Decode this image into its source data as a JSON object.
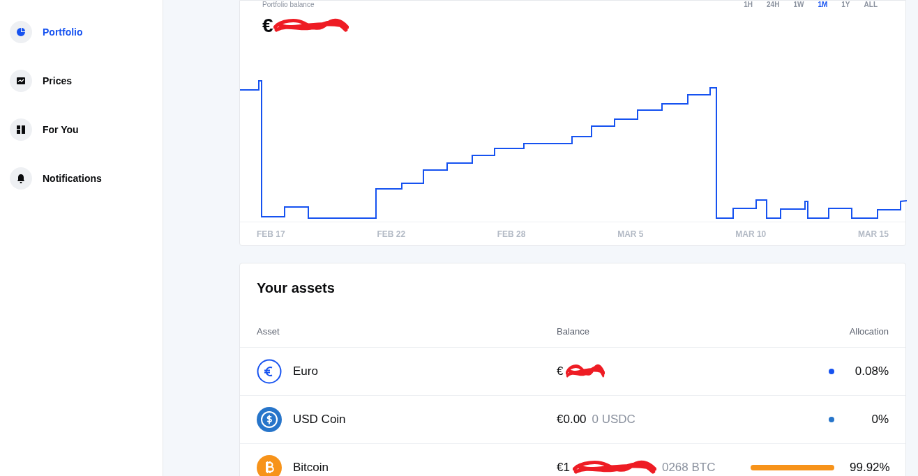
{
  "sidebar": {
    "items": [
      {
        "label": "Portfolio",
        "kind": "pie",
        "selected": true
      },
      {
        "label": "Prices",
        "kind": "chart",
        "selected": false
      },
      {
        "label": "For You",
        "kind": "grid",
        "selected": false
      },
      {
        "label": "Notifications",
        "kind": "bell",
        "selected": false
      }
    ]
  },
  "balance": {
    "label": "Portfolio balance",
    "value": "€"
  },
  "ranges": [
    {
      "label": "1H",
      "selected": false
    },
    {
      "label": "24H",
      "selected": false
    },
    {
      "label": "1W",
      "selected": false
    },
    {
      "label": "1M",
      "selected": true
    },
    {
      "label": "1Y",
      "selected": false
    },
    {
      "label": "ALL",
      "selected": false
    }
  ],
  "chart": {
    "x_labels": [
      "FEB 17",
      "FEB 22",
      "FEB 28",
      "MAR 5",
      "MAR 10",
      "MAR 15"
    ]
  },
  "assets": {
    "title": "Your assets",
    "columns": [
      "Asset",
      "Balance",
      "Allocation"
    ],
    "rows": [
      {
        "name": "Euro",
        "kind": "euro",
        "value": "€",
        "allocation": "0.08%",
        "full_bar": false,
        "color": "#1652f0",
        "redacted": true
      },
      {
        "name": "USD Coin",
        "kind": "usdc",
        "value": "€0.00",
        "amount": "0 USDC",
        "allocation": "0%",
        "full_bar": false,
        "color": "#2775ca",
        "redacted": false
      },
      {
        "name": "Bitcoin",
        "kind": "btc",
        "value": "€1",
        "amount": "0268 BTC",
        "allocation": "99.92%",
        "full_bar": true,
        "color": "#f7931a",
        "redacted": true
      }
    ]
  }
}
